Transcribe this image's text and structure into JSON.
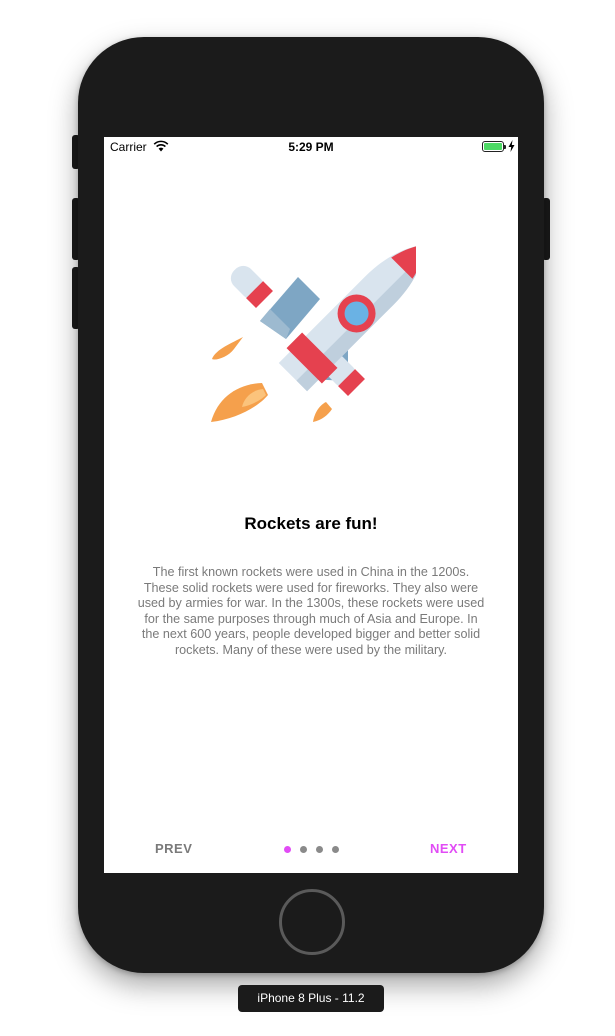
{
  "status_bar": {
    "carrier": "Carrier",
    "time": "5:29 PM"
  },
  "onboarding": {
    "title": "Rockets are fun!",
    "description": "The first known rockets were used in China in the 1200s. These solid rockets were used for fireworks. They also were used by armies for war. In the 1300s, these rockets were used for the same purposes through much of Asia and Europe. In the next 600 years, people developed bigger and better solid rockets. Many of these were used by the military.",
    "prev_label": "PREV",
    "next_label": "NEXT",
    "page_count": 4,
    "current_page": 1
  },
  "colors": {
    "accent": "#e14cf5",
    "inactive": "#7a7a7a",
    "battery": "#4cd964",
    "rocket_red": "#e5414f"
  },
  "device_label": "iPhone 8 Plus - 11.2"
}
